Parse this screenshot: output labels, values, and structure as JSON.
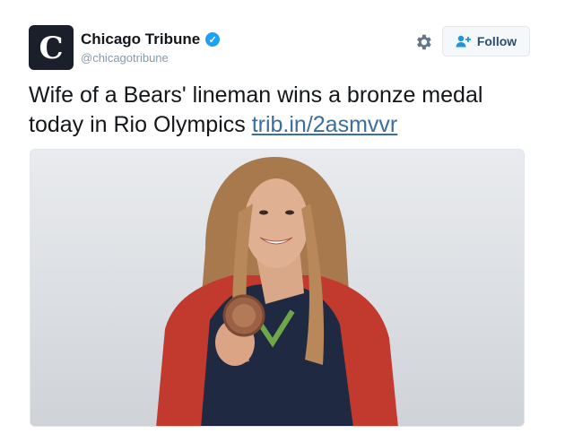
{
  "author": {
    "avatar_letter": "C",
    "display_name": "Chicago Tribune",
    "handle": "@chicagotribune",
    "verified": true
  },
  "actions": {
    "follow_label": "Follow"
  },
  "tweet": {
    "text": "Wife of a Bears' lineman wins a bronze medal today in Rio Olympics ",
    "link_text": "trib.in/2asmvvr"
  },
  "colors": {
    "verified": "#1da1f2",
    "link": "#3b6e9f",
    "avatar_bg": "#1b1f2a"
  }
}
